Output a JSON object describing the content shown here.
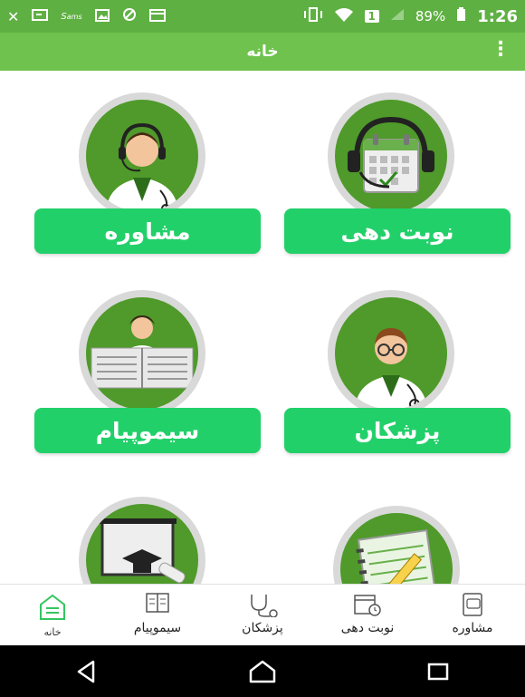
{
  "status_bar": {
    "time": "1:26",
    "battery": "89%",
    "sim_badge": "1",
    "icons": [
      "close-icon",
      "message-icon",
      "samsung-icon",
      "image-icon",
      "no-touch-icon",
      "calendar-icon",
      "vibrate-icon",
      "wifi-icon",
      "signal-icon",
      "battery-icon"
    ]
  },
  "app_bar": {
    "title": "خانه",
    "menu_icon": "more-vert-icon"
  },
  "tiles": [
    {
      "label": "مشاوره",
      "icon": "doctor-headset-icon"
    },
    {
      "label": "نوبت دهی",
      "icon": "calendar-headset-icon"
    },
    {
      "label": "سیموپیام",
      "icon": "newspaper-icon"
    },
    {
      "label": "پزشکان",
      "icon": "doctor-icon"
    },
    {
      "label": "",
      "icon": "graduation-icon"
    },
    {
      "label": "",
      "icon": "notebook-icon"
    }
  ],
  "bottom_nav": [
    {
      "label": "خانه",
      "icon": "home-icon",
      "active": true
    },
    {
      "label": "سیموپیام",
      "icon": "news-icon",
      "active": false
    },
    {
      "label": "پزشکان",
      "icon": "stethoscope-icon",
      "active": false
    },
    {
      "label": "نوبت دهی",
      "icon": "calendar-clock-icon",
      "active": false
    },
    {
      "label": "مشاوره",
      "icon": "tablet-chat-icon",
      "active": false
    }
  ],
  "system_nav": [
    "back-icon",
    "home-icon",
    "recents-icon"
  ],
  "colors": {
    "status_bar": "#5fb043",
    "app_bar": "#6fc24d",
    "button": "#22d06a",
    "circle_fill": "#4f9a2a",
    "circle_ring": "#d9d9d9"
  }
}
